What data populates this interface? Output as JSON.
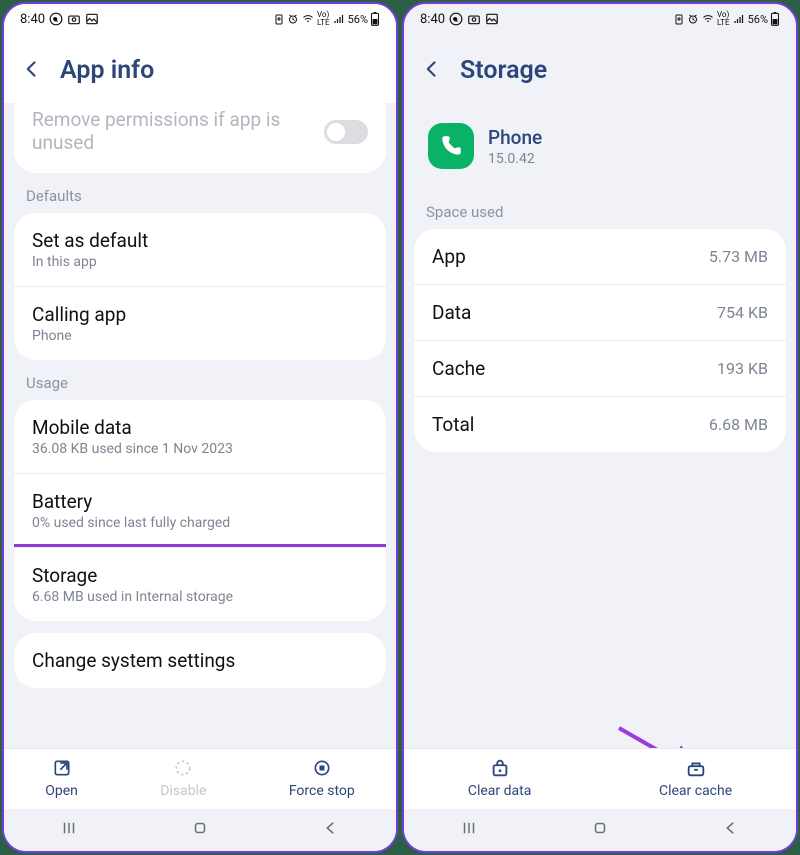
{
  "status": {
    "time": "8:40",
    "battery": "56%",
    "net_label": "Vo) LTE"
  },
  "left": {
    "title": "App info",
    "perm_text": "Remove permissions if app is unused",
    "defaults_header": "Defaults",
    "set_default_title": "Set as default",
    "set_default_sub": "In this app",
    "calling_title": "Calling app",
    "calling_sub": "Phone",
    "usage_header": "Usage",
    "mobile_title": "Mobile data",
    "mobile_sub": "36.08 KB used since 1 Nov 2023",
    "battery_title": "Battery",
    "battery_sub": "0% used since last fully charged",
    "storage_title": "Storage",
    "storage_sub": "6.68 MB used in Internal storage",
    "change_sys": "Change system settings",
    "open": "Open",
    "disable": "Disable",
    "force": "Force stop"
  },
  "right": {
    "title": "Storage",
    "app_name": "Phone",
    "app_ver": "15.0.42",
    "space_used": "Space used",
    "rows": {
      "app_k": "App",
      "app_v": "5.73 MB",
      "data_k": "Data",
      "data_v": "754 KB",
      "cache_k": "Cache",
      "cache_v": "193 KB",
      "total_k": "Total",
      "total_v": "6.68 MB"
    },
    "clear_data": "Clear data",
    "clear_cache": "Clear cache"
  }
}
